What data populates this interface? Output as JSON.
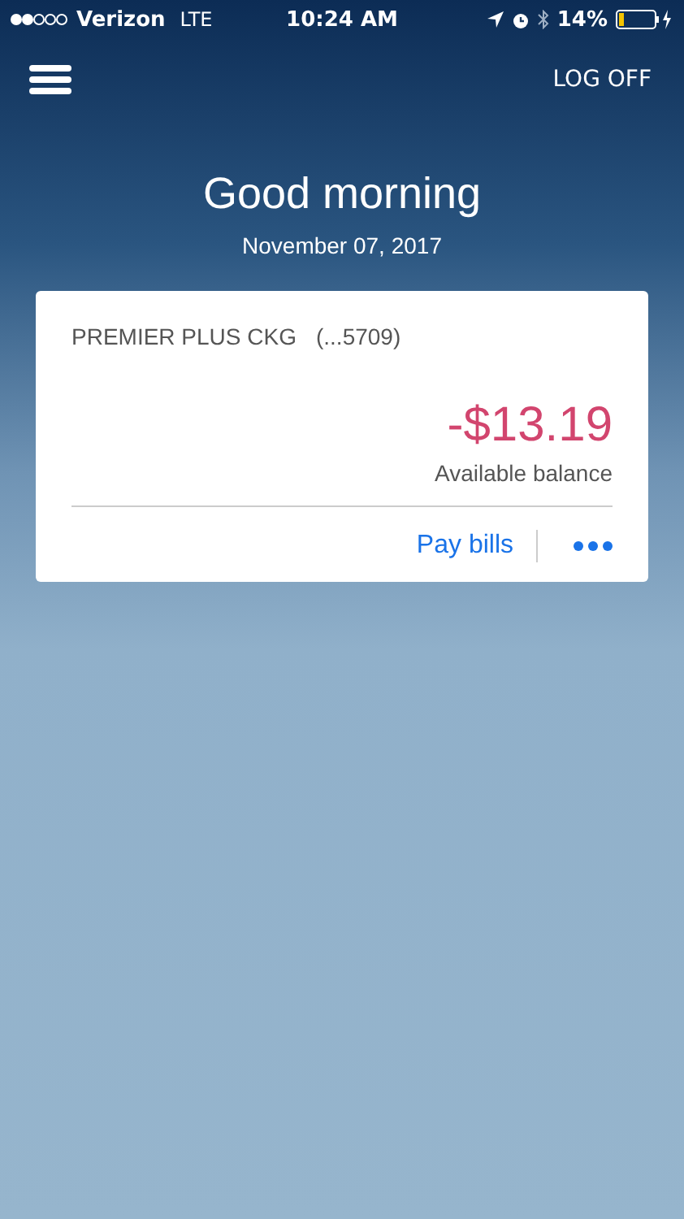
{
  "status_bar": {
    "carrier": "Verizon",
    "network": "LTE",
    "time": "10:24 AM",
    "battery": "14%"
  },
  "header": {
    "logoff": "LOG OFF"
  },
  "greeting": {
    "title": "Good morning",
    "date": "November 07, 2017"
  },
  "accounts": [
    {
      "name": "PREMIER PLUS CKG",
      "number": "(...5709)",
      "balance": "-$13.19",
      "negative": true,
      "balance_label": "Available balance",
      "action": "Pay bills"
    }
  ]
}
